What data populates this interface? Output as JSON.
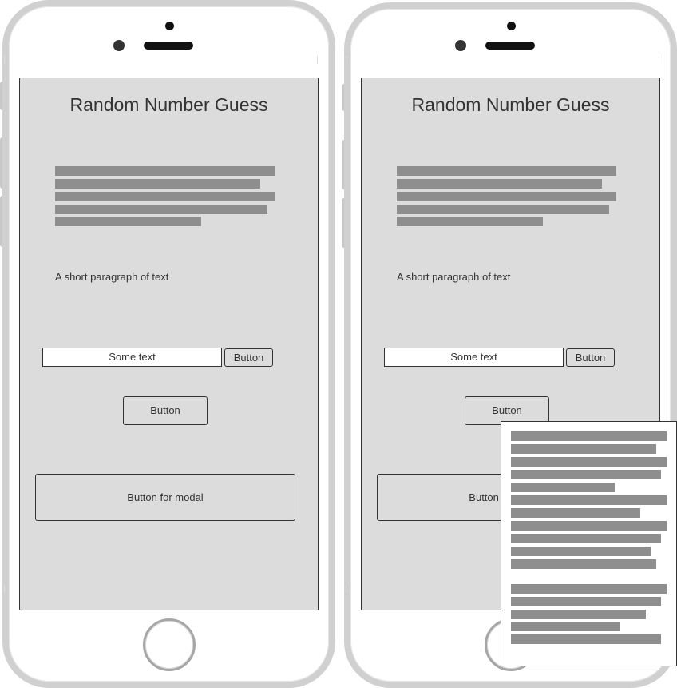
{
  "screens": [
    {
      "title": "Random Number Guess",
      "paragraph": "A short paragraph of text",
      "text_input_value": "Some text",
      "inline_button_label": "Button",
      "center_button_label": "Button",
      "modal_button_label": "Button for modal"
    },
    {
      "title": "Random Number Guess",
      "paragraph": "A short paragraph of text",
      "text_input_value": "Some text",
      "inline_button_label": "Button",
      "center_button_label": "Button",
      "modal_button_label": "Button for modal",
      "modal_open": true
    }
  ],
  "colors": {
    "screen_bg": "#dcdcdc",
    "placeholder_bar": "#8e8e8e",
    "phone_frame": "#d0d0d0"
  },
  "icons": [
    "front-camera-icon",
    "earpiece-icon",
    "home-button-icon"
  ]
}
